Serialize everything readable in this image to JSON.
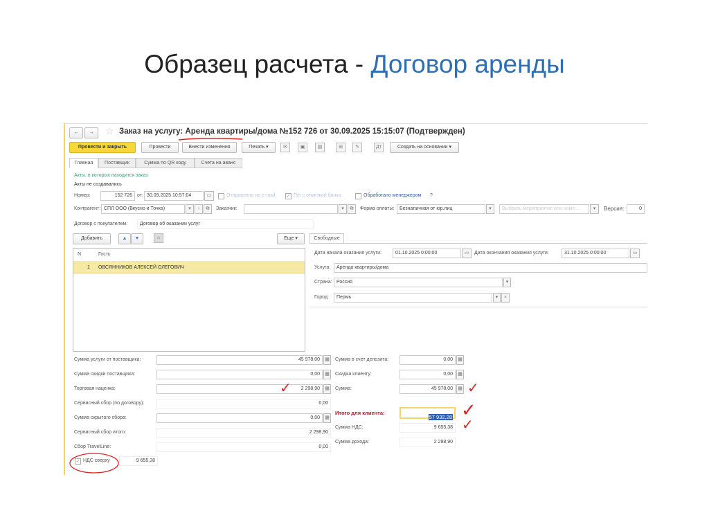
{
  "slide": {
    "title_prefix": "Образец расчета - ",
    "title_highlight": "Договор аренды"
  },
  "window": {
    "title_prefix": "Заказ на услугу: ",
    "title_main": "Аренда квартиры/дома №152 726 от 30.09.2025 15:15:07 (Подтвержден)"
  },
  "toolbar": {
    "post_close": "Провести и закрыть",
    "post": "Провести",
    "edit": "Внести изменения",
    "print": "Печать",
    "create_based": "Создать на основании"
  },
  "tabs": [
    "Главная",
    "Поставщик",
    "Сумма по QR коду",
    "Счета на аванс"
  ],
  "acts": {
    "link": "Акты, в которых находится заказ",
    "status": "Акты не создавались"
  },
  "header": {
    "number_label": "Номер:",
    "number": "152 726",
    "date_label": "от:",
    "date": "30.09.2025 10:57:04",
    "sent_email": "Отправлено по e-mail",
    "bank_statement": "П/п с отметкой банка",
    "processed_manager": "Обработано менеджером",
    "help": "?",
    "counterparty_label": "Контрагент:",
    "counterparty": "СПЛ ООО (Вкусно и Точка)",
    "customer_label": "Заказчик:",
    "customer": "",
    "payment_label": "Форма оплаты:",
    "payment": "Безналичная от юр.лиц",
    "event_placeholder": "Выбрать мероприятие или номе...",
    "version_label": "Версия:",
    "version": "0",
    "contract_label": "Договор с покупателем:",
    "contract": "Договор об оказании услуг"
  },
  "guests": {
    "add": "Добавить",
    "more": "Еще",
    "columns": [
      "N",
      "Гость"
    ],
    "rows": [
      {
        "n": "1",
        "name": "ОВСЯННИКОВ АЛЕКСЕЙ ОЛЕГОВИЧ"
      }
    ]
  },
  "free": {
    "tab": "Свободные",
    "start_label": "Дата начала оказания услуги:",
    "start": "01.10.2025  0:00:00",
    "end_label": "Дата окончания оказания услуги:",
    "end": "31.10.2025  0:00:00",
    "service_label": "Услуга:",
    "service": "Аренда квартиры/дома",
    "country_label": "Страна:",
    "country": "Россия",
    "city_label": "Город:",
    "city": "Пермь"
  },
  "amounts_left": [
    {
      "label": "Сумма услуги от поставщика:",
      "value": "45 978,00"
    },
    {
      "label": "Сумма скидки поставщика:",
      "value": "0,00"
    },
    {
      "label": "Торговая наценка:",
      "value": "2 298,90"
    },
    {
      "label": "Сервисный сбор (по договору):",
      "value": "0,00"
    },
    {
      "label": "Сумма скрытого сбора:",
      "value": "0,00"
    },
    {
      "label": "Сервисный сбор итого:",
      "value": "2 298,90"
    },
    {
      "label": "Сбор TravelLine:",
      "value": "0,00"
    }
  ],
  "vat_on_top": {
    "label": "НДС сверху",
    "value": "9 655,38",
    "checked": true
  },
  "amounts_right": [
    {
      "label": "Сумма в счет депозита:",
      "value": "0,00"
    },
    {
      "label": "Скидка клиенту:",
      "value": "0,00"
    },
    {
      "label": "Сумма:",
      "value": "45 978,00"
    }
  ],
  "total": {
    "label": "Итого для клиента:",
    "value": "57 932,28"
  },
  "vat": {
    "label": "Сумма НДС:",
    "value": "9 655,38"
  },
  "income": {
    "label": "Сумма дохода:",
    "value": "2 298,90"
  },
  "colors": {
    "accent_blue": "#2d6fb5",
    "annotation_red": "#d22222",
    "primary_button": "#f7d83a"
  }
}
